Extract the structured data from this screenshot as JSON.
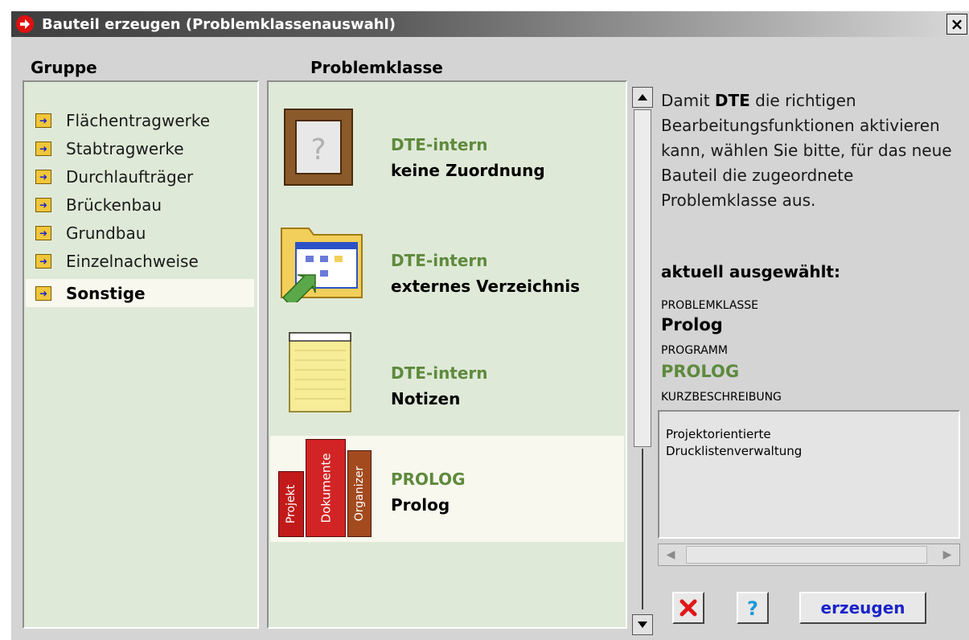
{
  "window": {
    "title": "Bauteil erzeugen (Problemklassenauswahl)",
    "close_symbol": "×"
  },
  "columns": {
    "group_header": "Gruppe",
    "problemclass_header": "Problemklasse"
  },
  "groups": [
    {
      "label": "Flächentragwerke",
      "selected": false
    },
    {
      "label": "Stabtragwerke",
      "selected": false
    },
    {
      "label": "Durchlaufträger",
      "selected": false
    },
    {
      "label": "Brückenbau",
      "selected": false
    },
    {
      "label": "Grundbau",
      "selected": false
    },
    {
      "label": "Einzelnachweise",
      "selected": false
    },
    {
      "label": "Sonstige",
      "selected": true
    }
  ],
  "problemclasses": [
    {
      "program": "DTE-intern",
      "name": "keine Zuordnung",
      "icon": "question-frame-icon",
      "selected": false
    },
    {
      "program": "DTE-intern",
      "name": "externes Verzeichnis",
      "icon": "folder-shortcut-icon",
      "selected": false
    },
    {
      "program": "DTE-intern",
      "name": "Notizen",
      "icon": "notepad-icon",
      "selected": false
    },
    {
      "program": "PROLOG",
      "name": "Prolog",
      "icon": "binders-icon",
      "selected": true,
      "icon_labels": [
        "Projekt",
        "Dokumente",
        "Organizer"
      ]
    }
  ],
  "info": {
    "text_before": "Damit ",
    "text_bold": "DTE",
    "text_after": " die richtigen Bearbeitungsfunktionen aktivieren kann, wählen Sie bitte, für das neue Bauteil die zugeordnete Problemklasse aus.",
    "current_heading": "aktuell ausgewählt:",
    "problemclass_label": "PROBLEMKLASSE",
    "problemclass_value": "Prolog",
    "program_label": "PROGRAMM",
    "program_value": "PROLOG",
    "description_label": "KURZBESCHREIBUNG",
    "description_value_line1": "Projektorientierte",
    "description_value_line2": "Drucklistenverwaltung"
  },
  "buttons": {
    "cancel_icon": "cancel-x-icon",
    "help_icon": "help-question-icon",
    "create_label": "erzeugen"
  },
  "colors": {
    "panel_bg": "#dfe9d8",
    "selected_bg": "#f8f8ee",
    "program_green": "#5e8a3c",
    "button_blue": "#1a24c8",
    "title_arrow_red": "#e01010"
  }
}
